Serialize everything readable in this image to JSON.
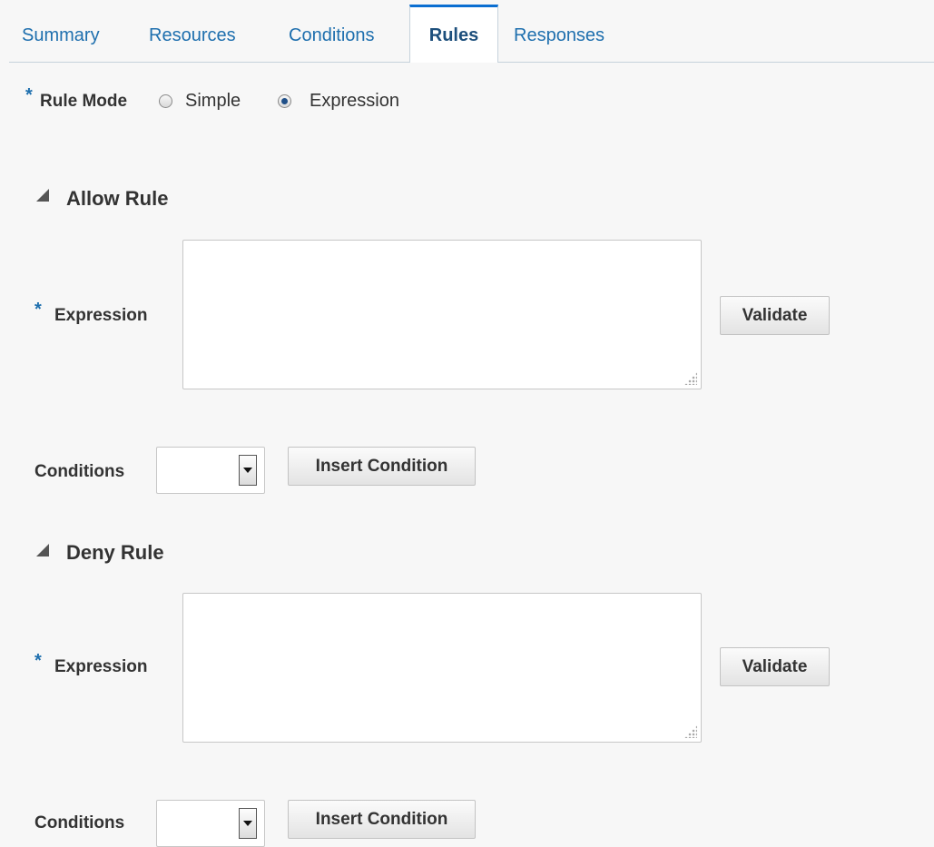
{
  "tabs": [
    {
      "label": "Summary"
    },
    {
      "label": "Resources"
    },
    {
      "label": "Conditions"
    },
    {
      "label": "Rules",
      "active": true
    },
    {
      "label": "Responses"
    }
  ],
  "required_marker": "*",
  "rule_mode": {
    "label": "Rule Mode",
    "options": [
      "Simple",
      "Expression"
    ],
    "selected": "Expression"
  },
  "allow_rule": {
    "title": "Allow Rule",
    "expression_label": "Expression",
    "expression_value": "",
    "validate_label": "Validate",
    "conditions_label": "Conditions",
    "conditions_value": "",
    "insert_label": "Insert Condition"
  },
  "deny_rule": {
    "title": "Deny Rule",
    "expression_label": "Expression",
    "expression_value": "",
    "validate_label": "Validate",
    "conditions_label": "Conditions",
    "conditions_value": "",
    "insert_label": "Insert Condition"
  },
  "colors": {
    "link": "#1e6fae",
    "active_tab_accent": "#0a6ed1",
    "background": "#f7f7f7"
  }
}
